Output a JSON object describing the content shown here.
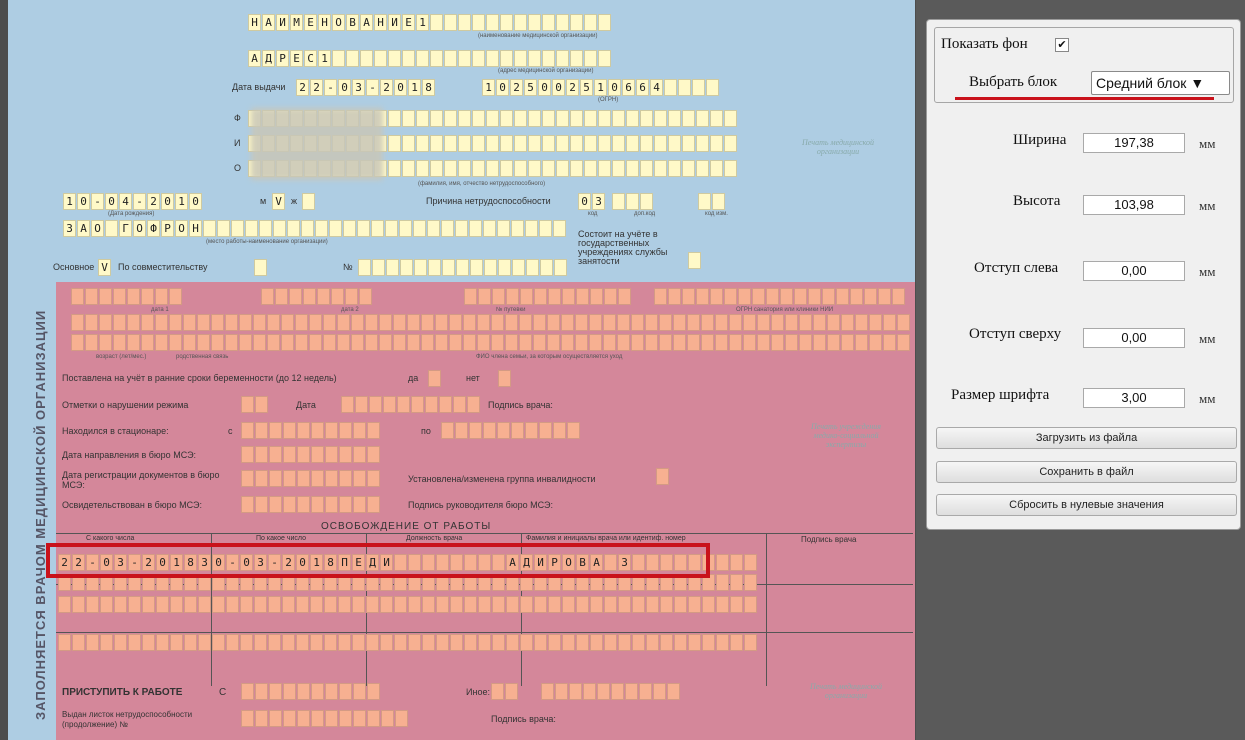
{
  "form": {
    "name_chars": [
      "Н",
      "А",
      "И",
      "М",
      "Е",
      "Н",
      "О",
      "В",
      "А",
      "Н",
      "И",
      "Е",
      "1"
    ],
    "name_caption": "(наименование медицинской организации)",
    "address_chars": [
      "А",
      "Д",
      "Р",
      "Е",
      "С",
      "1"
    ],
    "address_caption": "(адрес медицинской организации)",
    "issue_date_label": "Дата выдачи",
    "issue_date_chars": [
      "2",
      "2",
      "-",
      "0",
      "3",
      "-",
      "2",
      "0",
      "1",
      "8"
    ],
    "ogrn_chars": [
      "1",
      "0",
      "2",
      "5",
      "0",
      "0",
      "2",
      "5",
      "1",
      "0",
      "6",
      "6",
      "4"
    ],
    "ogrn_caption": "(ОГРН)",
    "f_label": "Ф",
    "i_label": "И",
    "o_label": "О",
    "fio_caption": "(фамилия, имя, отчество нетрудоспособного)",
    "birth_chars": [
      "1",
      "0",
      "-",
      "0",
      "4",
      "-",
      "2",
      "0",
      "1",
      "0"
    ],
    "birth_caption": "(Дата рождения)",
    "gender_m": "м",
    "gender_v": "V",
    "gender_f": "ж",
    "cause_label": "Причина нетрудоспособности",
    "cause_chars": [
      "0",
      "3"
    ],
    "code_caption": "код",
    "addcode_caption": "доп.код",
    "changecode_caption": "код изм.",
    "employer_chars": [
      "З",
      "А",
      "О",
      " ",
      "Г",
      "О",
      "Ф",
      "Р",
      "О",
      "Н"
    ],
    "employer_caption": "(место работы-наименование организации)",
    "main_label": "Основное",
    "main_check": "V",
    "part_label": "По совместительству",
    "num_label": "№",
    "registered_label": "Состоит на учёте в государственных учреждениях службы занятости",
    "vertical_text": "ЗАПОЛНЯЕТСЯ ВРАЧОМ МЕДИЦИНСКОЙ ОРГАНИЗАЦИИ",
    "date1_caption": "дата 1",
    "date2_caption": "дата 2",
    "putevka_caption": "№ путевки",
    "ogrn_sanatorium_caption": "ОГРН санатория или клиники НИИ",
    "care_caption": "по уходу",
    "age_caption": "возраст (лет/мес.)",
    "relation_caption": "родственная связь",
    "care_fio_caption": "ФИО члена семьи, за которым осуществляется уход",
    "pregnancy_label": "Поставлена на учёт в ранние сроки беременности (до 12 недель)",
    "yes_label": "да",
    "no_label": "нет",
    "violation_label": "Отметки о нарушении режима",
    "date_label": "Дата",
    "doctor_signature_label": "Подпись врача:",
    "hospital_label": "Находился в стационаре:",
    "from_label": "с",
    "to_label": "по",
    "mse_direction_label": "Дата направления в бюро МСЭ:",
    "mse_registration_label": "Дата регистрации документов в бюро МСЭ:",
    "disability_label": "Установлена/изменена группа инвалидности",
    "mse_examined_label": "Освидетельствован в бюро МСЭ:",
    "mse_head_signature_label": "Подпись руководителя бюро МСЭ:",
    "release_title": "ОСВОБОЖДЕНИЕ ОТ РАБОТЫ",
    "release_col1": "С какого числа",
    "release_col2": "По какое число",
    "release_col3": "Должность врача",
    "release_col4": "Фамилия и инициалы врача или идентиф. номер",
    "release_col5": "Подпись врача",
    "release_row1_chars": [
      "2",
      "2",
      "-",
      "0",
      "3",
      "-",
      "2",
      "0",
      "1",
      "8",
      "3",
      "0",
      "-",
      "0",
      "3",
      "-",
      "2",
      "0",
      "1",
      "8",
      "П",
      "Е",
      "Д",
      "И",
      " ",
      " ",
      " ",
      " ",
      " ",
      " ",
      " ",
      " ",
      "А",
      "Д",
      "И",
      "Р",
      "О",
      "В",
      "А",
      " ",
      "З"
    ],
    "start_work_label": "ПРИСТУПИТЬ К РАБОТЕ",
    "start_from_label": "С",
    "other_label": "Иное:",
    "continued_label": "Выдан листок нетрудоспособности (продолжение) №",
    "stamp_text": "Печать медицинской организации",
    "stamp_mse_text": "Печать учреждения медико-социальной экспертизы"
  },
  "panel": {
    "show_bg_label": "Показать фон",
    "show_bg_check": "✔",
    "block_label": "Выбрать блок",
    "block_value": "Средний блок ▼",
    "width_label": "Ширина",
    "width_value": "197,38",
    "height_label": "Высота",
    "height_value": "103,98",
    "left_label": "Отступ слева",
    "left_value": "0,00",
    "top_label": "Отступ сверху",
    "top_value": "0,00",
    "font_label": "Размер шрифта",
    "font_value": "3,00",
    "unit": "мм",
    "load_button": "Загрузить из файла",
    "save_button": "Сохранить в файл",
    "reset_button": "Сбросить в нулевые значения"
  },
  "colors": {
    "highlight": "#c9121b",
    "form_blue": "#aecde3",
    "form_pink": "#d4879a",
    "cell_yellow": "#fff9c8",
    "cell_orange": "#f7b091"
  }
}
